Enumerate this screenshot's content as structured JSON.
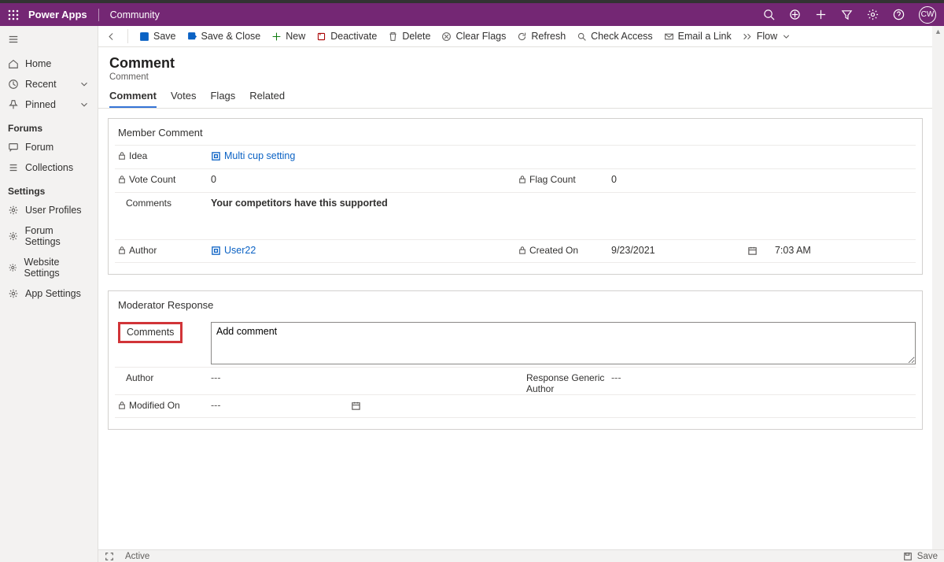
{
  "top": {
    "brand": "Power Apps",
    "context": "Community",
    "avatar_initials": "CW"
  },
  "sidebar": {
    "items_primary": [
      {
        "label": "Home",
        "icon": "home"
      },
      {
        "label": "Recent",
        "icon": "clock",
        "chev": true
      },
      {
        "label": "Pinned",
        "icon": "pin",
        "chev": true
      }
    ],
    "group_forums": "Forums",
    "forums_items": [
      {
        "label": "Forum",
        "icon": "forum"
      },
      {
        "label": "Collections",
        "icon": "list"
      }
    ],
    "group_settings": "Settings",
    "settings_items": [
      {
        "label": "User Profiles",
        "icon": "gear"
      },
      {
        "label": "Forum Settings",
        "icon": "gear"
      },
      {
        "label": "Website Settings",
        "icon": "gear"
      },
      {
        "label": "App Settings",
        "icon": "gear"
      }
    ]
  },
  "cmdbar": {
    "save": "Save",
    "save_close": "Save & Close",
    "new": "New",
    "deactivate": "Deactivate",
    "delete": "Delete",
    "clear_flags": "Clear Flags",
    "refresh": "Refresh",
    "check_access": "Check Access",
    "email_link": "Email a Link",
    "flow": "Flow"
  },
  "page": {
    "title": "Comment",
    "subtitle": "Comment"
  },
  "tabs": {
    "comment": "Comment",
    "votes": "Votes",
    "flags": "Flags",
    "related": "Related"
  },
  "member_comment": {
    "section_title": "Member Comment",
    "idea_label": "Idea",
    "idea_value": "Multi cup setting",
    "vote_count_label": "Vote Count",
    "vote_count_value": "0",
    "flag_count_label": "Flag Count",
    "flag_count_value": "0",
    "comments_label": "Comments",
    "comments_value": "Your competitors have this supported",
    "author_label": "Author",
    "author_value": "User22",
    "created_on_label": "Created On",
    "created_on_date": "9/23/2021",
    "created_on_time": "7:03 AM"
  },
  "moderator_response": {
    "section_title": "Moderator Response",
    "comments_label": "Comments",
    "comments_value": "Add comment",
    "author_label": "Author",
    "author_value": "---",
    "generic_author_label": "Response Generic Author",
    "generic_author_value": "---",
    "modified_on_label": "Modified On",
    "modified_on_value": "---"
  },
  "status": {
    "active": "Active",
    "save": "Save"
  }
}
